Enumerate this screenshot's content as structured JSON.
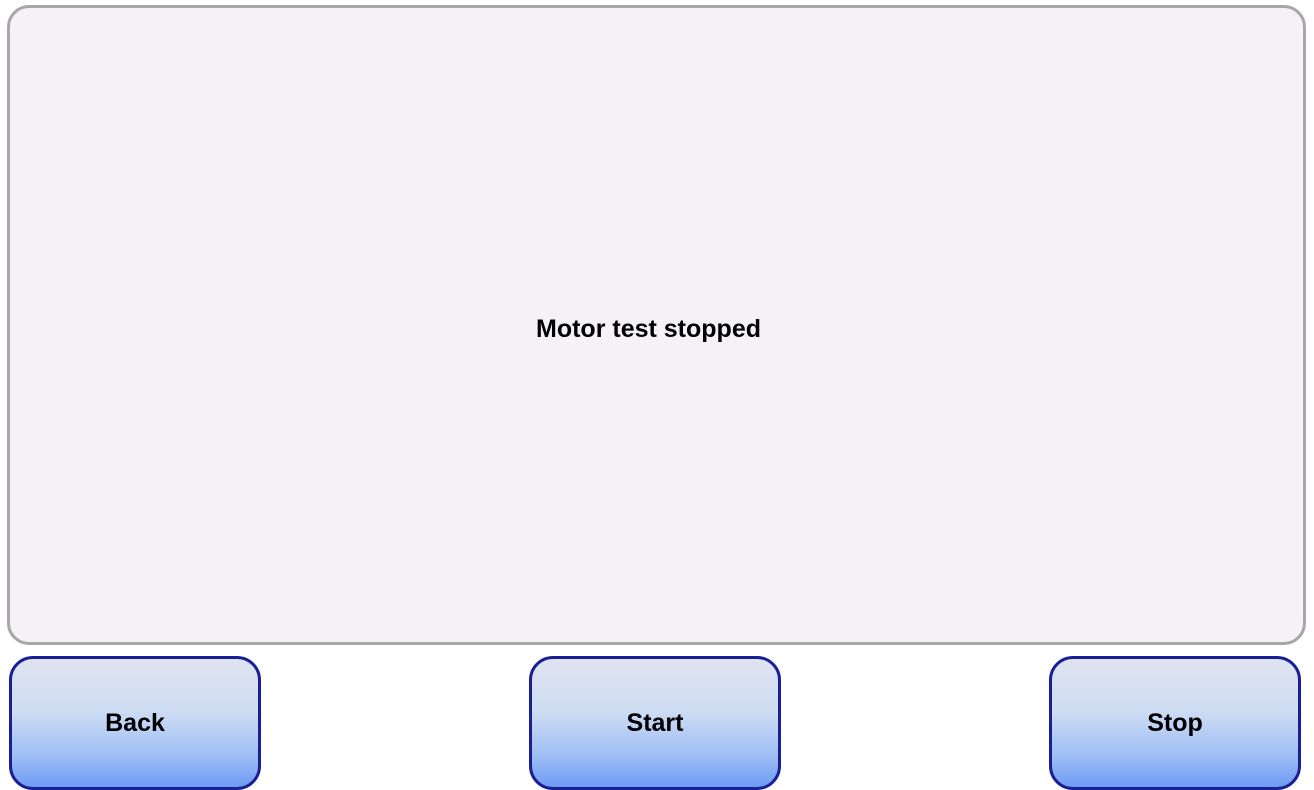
{
  "status": {
    "message": "Motor test stopped"
  },
  "buttons": {
    "back_label": "Back",
    "start_label": "Start",
    "stop_label": "Stop"
  },
  "colors": {
    "panel_background": "#f6f1f6",
    "panel_border": "#a7a7a7",
    "button_border": "#1a1f96",
    "button_gradient_top": "#dfe3ef",
    "button_gradient_bottom": "#6e9cf4"
  }
}
